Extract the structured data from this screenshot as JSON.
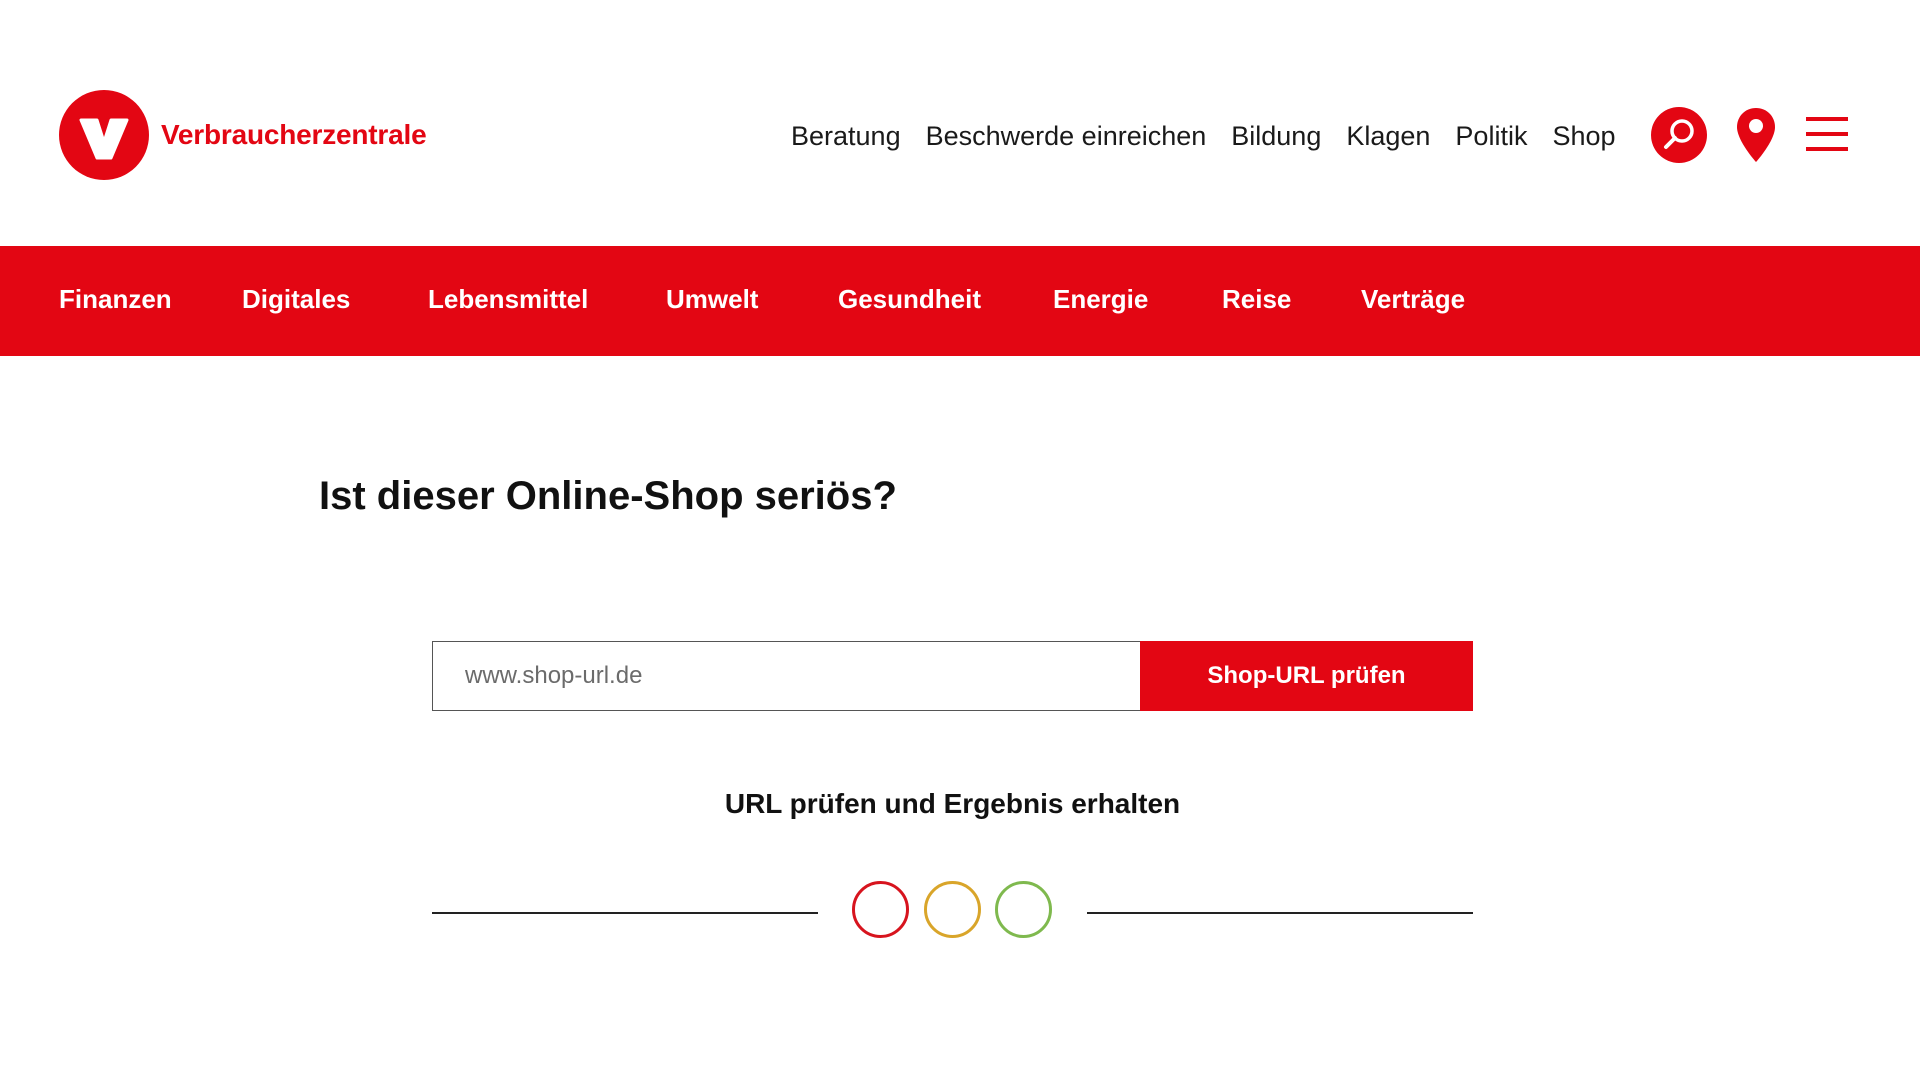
{
  "brand": {
    "name": "Verbraucherzentrale",
    "color": "#e30613"
  },
  "top_nav": {
    "items": [
      "Beratung",
      "Beschwerde einreichen",
      "Bildung",
      "Klagen",
      "Politik",
      "Shop"
    ]
  },
  "header_icons": {
    "search": "search-icon",
    "location": "location-pin-icon",
    "menu": "hamburger-menu-icon"
  },
  "categories": {
    "items": [
      "Finanzen",
      "Digitales",
      "Lebensmittel",
      "Umwelt",
      "Gesundheit",
      "Energie",
      "Reise",
      "Verträge"
    ]
  },
  "main": {
    "title": "Ist dieser Online-Shop seriös?",
    "url_input": {
      "value": "",
      "placeholder": "www.shop-url.de"
    },
    "submit_label": "Shop-URL prüfen",
    "result_caption": "URL prüfen und Ergebnis erhalten"
  },
  "traffic_lights": {
    "red": "#d7141e",
    "yellow": "#d9a52a",
    "green": "#7fb94e"
  }
}
